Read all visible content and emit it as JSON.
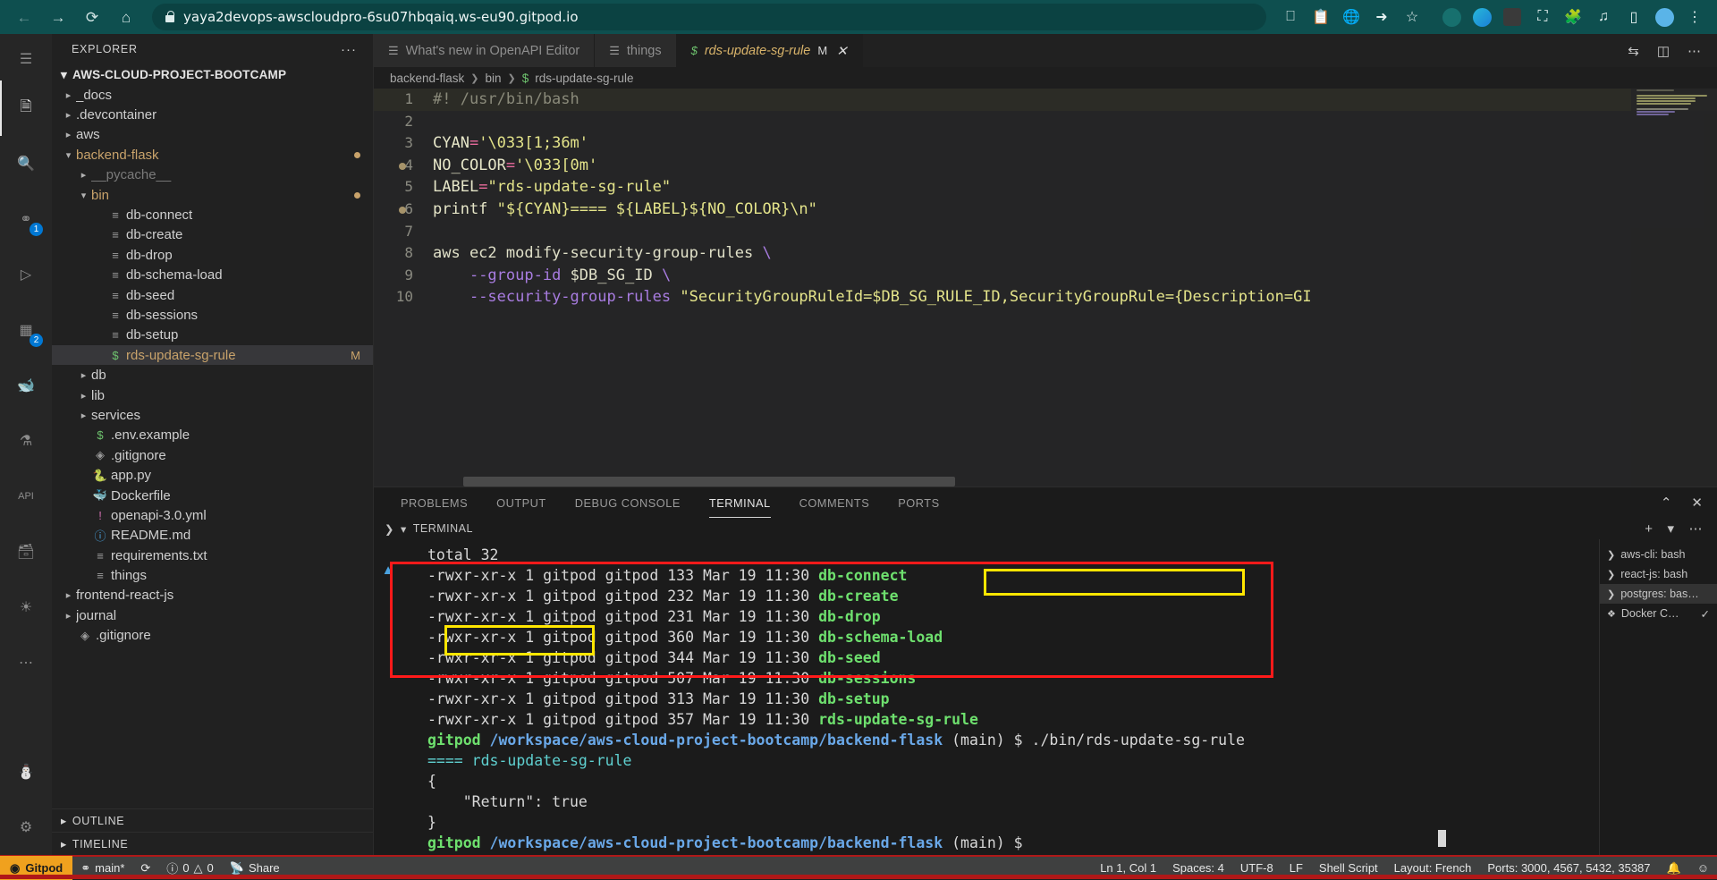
{
  "browser": {
    "url": "yaya2devops-awscloudpro-6su07hbqaiq.ws-eu90.gitpod.io",
    "back_icon": "back-arrow-icon",
    "forward_icon": "forward-arrow-icon",
    "reload_icon": "reload-icon",
    "home_icon": "home-icon",
    "lock_icon": "lock-icon",
    "toolbar_icons": [
      "split-screen-icon",
      "clipboard-icon",
      "translate-icon",
      "share-icon",
      "bookmark-star-icon"
    ],
    "extension_icons": [
      "teal-circle-extension-icon",
      "diamond-extension-icon",
      "dark-square-extension-icon",
      "capture-frame-icon",
      "puzzle-extensions-icon",
      "playlist-icon",
      "reading-panel-icon",
      "profile-avatar-icon"
    ],
    "menu_icon": "kebab-menu-icon"
  },
  "activity_bar": {
    "menu_icon": "hamburger-menu-icon",
    "items": [
      {
        "name": "explorer",
        "icon": "files-icon",
        "badge": "",
        "active": true
      },
      {
        "name": "search",
        "icon": "search-icon",
        "badge": "",
        "active": false
      },
      {
        "name": "source-control",
        "icon": "source-control-icon",
        "badge": "1",
        "active": false
      },
      {
        "name": "run-and-debug",
        "icon": "run-debug-icon",
        "badge": "",
        "active": false
      },
      {
        "name": "extensions",
        "icon": "extensions-icon",
        "badge": "2",
        "active": false
      },
      {
        "name": "docker",
        "icon": "docker-icon",
        "badge": "",
        "active": false
      },
      {
        "name": "testing",
        "icon": "beaker-icon",
        "badge": "",
        "active": false
      },
      {
        "name": "openapi",
        "icon": "api-icon",
        "badge": "",
        "active": false
      },
      {
        "name": "database",
        "icon": "database-icon",
        "badge": "",
        "active": false
      },
      {
        "name": "github",
        "icon": "github-icon",
        "badge": "",
        "active": false
      },
      {
        "name": "more",
        "icon": "ellipsis-icon",
        "badge": "",
        "active": false
      }
    ],
    "bottom_items": [
      {
        "name": "accounts",
        "icon": "account-icon"
      },
      {
        "name": "settings",
        "icon": "gear-icon"
      }
    ]
  },
  "sidebar": {
    "title": "EXPLORER",
    "more_actions": "···",
    "root": "AWS-CLOUD-PROJECT-BOOTCAMP",
    "tree": [
      {
        "label": "_docs",
        "depth": 1,
        "type": "folder",
        "expanded": false,
        "color": "clr-folder"
      },
      {
        "label": ".devcontainer",
        "depth": 1,
        "type": "folder",
        "expanded": false,
        "color": "clr-folder"
      },
      {
        "label": "aws",
        "depth": 1,
        "type": "folder",
        "expanded": false,
        "color": "clr-folder"
      },
      {
        "label": "backend-flask",
        "depth": 1,
        "type": "folder",
        "expanded": true,
        "color": "clr-mod",
        "dot": true
      },
      {
        "label": "__pycache__",
        "depth": 2,
        "type": "folder",
        "expanded": false,
        "color": "clr-dim"
      },
      {
        "label": "bin",
        "depth": 2,
        "type": "folder",
        "expanded": true,
        "color": "clr-mod",
        "dot": true
      },
      {
        "label": "db-connect",
        "depth": 3,
        "type": "script",
        "icon": "lines-file-icon",
        "color": "clr-folder"
      },
      {
        "label": "db-create",
        "depth": 3,
        "type": "script",
        "icon": "lines-file-icon",
        "color": "clr-folder"
      },
      {
        "label": "db-drop",
        "depth": 3,
        "type": "script",
        "icon": "lines-file-icon",
        "color": "clr-folder"
      },
      {
        "label": "db-schema-load",
        "depth": 3,
        "type": "script",
        "icon": "lines-file-icon",
        "color": "clr-folder"
      },
      {
        "label": "db-seed",
        "depth": 3,
        "type": "script",
        "icon": "lines-file-icon",
        "color": "clr-folder"
      },
      {
        "label": "db-sessions",
        "depth": 3,
        "type": "script",
        "icon": "lines-file-icon",
        "color": "clr-folder"
      },
      {
        "label": "db-setup",
        "depth": 3,
        "type": "script",
        "icon": "lines-file-icon",
        "color": "clr-folder"
      },
      {
        "label": "rds-update-sg-rule",
        "depth": 3,
        "type": "shell",
        "icon": "dollar-shell-icon",
        "color": "clr-mod",
        "selected": true,
        "mark": "M"
      },
      {
        "label": "db",
        "depth": 2,
        "type": "folder",
        "expanded": false,
        "color": "clr-folder"
      },
      {
        "label": "lib",
        "depth": 2,
        "type": "folder",
        "expanded": false,
        "color": "clr-folder"
      },
      {
        "label": "services",
        "depth": 2,
        "type": "folder",
        "expanded": false,
        "color": "clr-folder"
      },
      {
        "label": ".env.example",
        "depth": 2,
        "type": "shell",
        "icon": "dollar-shell-icon",
        "color": "clr-folder"
      },
      {
        "label": ".gitignore",
        "depth": 2,
        "type": "git",
        "icon": "git-icon",
        "color": "clr-folder"
      },
      {
        "label": "app.py",
        "depth": 2,
        "type": "python",
        "icon": "python-icon",
        "color": "clr-folder"
      },
      {
        "label": "Dockerfile",
        "depth": 2,
        "type": "docker",
        "icon": "docker-whale-icon",
        "color": "clr-folder"
      },
      {
        "label": "openapi-3.0.yml",
        "depth": 2,
        "type": "yaml",
        "icon": "openapi-icon",
        "color": "clr-folder"
      },
      {
        "label": "README.md",
        "depth": 2,
        "type": "md",
        "icon": "info-circle-icon",
        "color": "clr-folder"
      },
      {
        "label": "requirements.txt",
        "depth": 2,
        "type": "text",
        "icon": "lines-file-icon",
        "color": "clr-folder"
      },
      {
        "label": "things",
        "depth": 2,
        "type": "text",
        "icon": "lines-file-icon",
        "color": "clr-folder"
      },
      {
        "label": "frontend-react-js",
        "depth": 1,
        "type": "folder",
        "expanded": false,
        "color": "clr-folder"
      },
      {
        "label": "journal",
        "depth": 1,
        "type": "folder",
        "expanded": false,
        "color": "clr-folder"
      },
      {
        "label": ".gitignore",
        "depth": 1,
        "type": "git",
        "icon": "git-icon",
        "color": "clr-folder"
      }
    ],
    "sections": [
      {
        "label": "OUTLINE"
      },
      {
        "label": "TIMELINE"
      }
    ]
  },
  "editor": {
    "tabs": [
      {
        "label": "What's new in OpenAPI Editor",
        "icon": "lines-file-icon",
        "active": false,
        "modified": ""
      },
      {
        "label": "things",
        "icon": "lines-file-icon",
        "active": false,
        "modified": ""
      },
      {
        "label": "rds-update-sg-rule",
        "icon": "dollar-shell-icon",
        "active": true,
        "modified": "M"
      }
    ],
    "tab_actions": [
      "split-editor-icon",
      "layout-icon",
      "more-actions-icon"
    ],
    "breadcrumb": [
      "backend-flask",
      "bin",
      "rds-update-sg-rule"
    ],
    "breadcrumb_icon": "dollar-shell-icon",
    "code": [
      {
        "n": "1",
        "html": "<span class='c-com'>#! /usr/bin/bash</span>",
        "highlight": true
      },
      {
        "n": "2",
        "html": ""
      },
      {
        "n": "3",
        "html": "<span class='c-var'>CYAN</span><span class='c-op'>=</span><span class='c-str'>'\\033[1;36m'</span>"
      },
      {
        "n": "4",
        "html": "<span class='c-var'>NO_COLOR</span><span class='c-op'>=</span><span class='c-str'>'\\033[0m'</span>",
        "glyph": true
      },
      {
        "n": "5",
        "html": "<span class='c-var'>LABEL</span><span class='c-op'>=</span><span class='c-str'>\"rds-update-sg-rule\"</span>"
      },
      {
        "n": "6",
        "html": "<span class='c-fn'>printf</span> <span class='c-str'>\"${CYAN}==== ${LABEL}${NO_COLOR}\\n\"</span>",
        "glyph": true
      },
      {
        "n": "7",
        "html": ""
      },
      {
        "n": "8",
        "html": "<span class='c-plain'>aws ec2 modify-security-group-rules</span> <span class='c-cont'>\\</span>"
      },
      {
        "n": "9",
        "html": "    <span class='c-kw'>--group-id</span> <span class='c-plain'>$DB_SG_ID</span> <span class='c-cont'>\\</span>"
      },
      {
        "n": "10",
        "html": "    <span class='c-kw'>--security-group-rules</span> <span class='c-str'>\"SecurityGroupRuleId=$DB_SG_RULE_ID,SecurityGroupRule={Description=GI</span>"
      }
    ]
  },
  "panel": {
    "tabs": [
      "PROBLEMS",
      "OUTPUT",
      "DEBUG CONSOLE",
      "TERMINAL",
      "COMMENTS",
      "PORTS"
    ],
    "active_tab": "TERMINAL",
    "actions": [
      "chevron-up-icon",
      "close-icon"
    ],
    "terminal_header": "TERMINAL",
    "terminal_header_actions": [
      "add-terminal-icon",
      "chevron-down-icon",
      "more-actions-icon"
    ],
    "output_lines": [
      {
        "html": "<span class='t-white'>total 32</span>"
      },
      {
        "html": "<span class='t-white'>-rwxr-xr-x 1 gitpod gitpod 133 Mar 19 11:30 </span><span class='t-green'>db-connect</span>"
      },
      {
        "html": "<span class='t-white'>-rwxr-xr-x 1 gitpod gitpod 232 Mar 19 11:30 </span><span class='t-green'>db-create</span>"
      },
      {
        "html": "<span class='t-white'>-rwxr-xr-x 1 gitpod gitpod 231 Mar 19 11:30 </span><span class='t-green'>db-drop</span>"
      },
      {
        "html": "<span class='t-white'>-rwxr-xr-x 1 gitpod gitpod 360 Mar 19 11:30 </span><span class='t-green'>db-schema-load</span>"
      },
      {
        "html": "<span class='t-white'>-rwxr-xr-x 1 gitpod gitpod 344 Mar 19 11:30 </span><span class='t-green'>db-seed</span>"
      },
      {
        "html": "<span class='t-white'>-rwxr-xr-x 1 gitpod gitpod 507 Mar 19 11:30 </span><span class='t-green'>db-sessions</span>"
      },
      {
        "html": "<span class='t-white'>-rwxr-xr-x 1 gitpod gitpod 313 Mar 19 11:30 </span><span class='t-green'>db-setup</span>"
      },
      {
        "html": "<span class='t-white'>-rwxr-xr-x 1 gitpod gitpod 357 Mar 19 11:30 </span><span class='t-green'>rds-update-sg-rule</span>"
      },
      {
        "html": "<span class='t-green'>gitpod </span><span class='t-blue'>/workspace/aws-cloud-project-bootcamp/backend-flask</span><span class='t-white'> (main) $ ./bin/rds-update-sg-rule</span>"
      },
      {
        "html": "<span class='t-cyan'>==== rds-update-sg-rule</span>"
      },
      {
        "html": "<span class='t-white'>{</span>"
      },
      {
        "html": "<span class='t-white'>    \"Return\": true</span>"
      },
      {
        "html": "<span class='t-white'>}</span>"
      },
      {
        "html": "<span class='t-green'>gitpod </span><span class='t-blue'>/workspace/aws-cloud-project-bootcamp/backend-flask</span><span class='t-white'> (main) $ </span>"
      }
    ],
    "terminal_list": [
      {
        "label": "aws-cli: bash",
        "icon": "terminal-icon",
        "active": false,
        "check": false
      },
      {
        "label": "react-js: bash",
        "icon": "terminal-icon",
        "active": false,
        "check": false
      },
      {
        "label": "postgres: bas…",
        "icon": "terminal-icon",
        "active": true,
        "check": false
      },
      {
        "label": "Docker C…",
        "icon": "docker-terminal-icon",
        "active": false,
        "check": true
      }
    ]
  },
  "status_bar": {
    "gitpod": {
      "label": "Gitpod",
      "icon": "gitpod-icon"
    },
    "left_items": [
      {
        "label": "main*",
        "icon": "branch-icon"
      },
      {
        "label": "",
        "icon": "sync-icon"
      },
      {
        "label": "0",
        "icon": "error-icon",
        "second_label": "0",
        "second_icon": "warning-icon"
      },
      {
        "label": "Share",
        "icon": "broadcast-icon"
      }
    ],
    "right_items": [
      {
        "label": "Ln 1, Col 1"
      },
      {
        "label": "Spaces: 4"
      },
      {
        "label": "UTF-8"
      },
      {
        "label": "LF"
      },
      {
        "label": "Shell Script"
      },
      {
        "label": "Layout: French"
      },
      {
        "label": "Ports: 3000, 4567, 5432, 35387"
      },
      {
        "label": "",
        "icon": "bell-icon"
      },
      {
        "label": "",
        "icon": "feedback-icon"
      }
    ]
  },
  "annotations": {
    "red_box_label": "terminal-command-and-output-highlight",
    "yellow_box_command": "./bin/rds-update-sg-rule",
    "yellow_box_result": "\"Return\": true"
  }
}
